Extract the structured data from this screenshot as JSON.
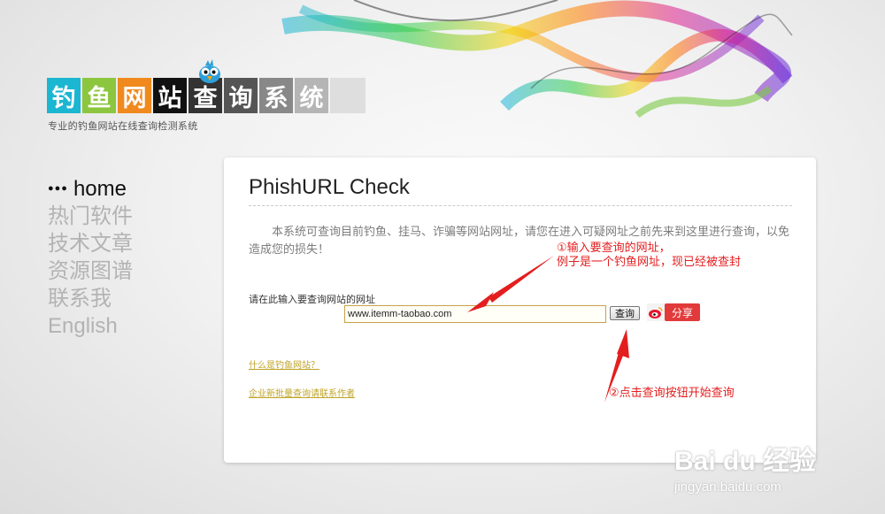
{
  "logo": {
    "chars": [
      "钓",
      "鱼",
      "网",
      "站",
      "查",
      "询",
      "系",
      "统"
    ],
    "colors": [
      "#1bb6d2",
      "#8cc63f",
      "#f08a1e",
      "#111111",
      "#333333",
      "#555555",
      "#888888",
      "#b5b5b5"
    ],
    "tagline": "专业的钓鱼网站在线查询检测系统"
  },
  "nav": {
    "active_dots": "●●●",
    "items": [
      "home",
      "热门软件",
      "技术文章",
      "资源图谱",
      "联系我",
      "English"
    ]
  },
  "main": {
    "title": "PhishURL Check",
    "intro": "本系统可查询目前钓鱼、挂马、诈骗等网站网址，请您在进入可疑网址之前先来到这里进行查询，以免造成您的损失！",
    "input_label": "请在此输入要查询网站的网址",
    "input_value": "www.itemm-taobao.com",
    "query_label": "查询",
    "share_label": "分享",
    "link_what_is": "什么是钓鱼网站？",
    "link_contact": "企业新批量查询请联系作者"
  },
  "annotations": {
    "note1_line1": "①输入要查询的网址，",
    "note1_line2": "例子是一个钓鱼网址，现已经被查封",
    "note2": "②点击查询按钮开始查询"
  },
  "watermark": {
    "brand": "Bai du 经验",
    "url": "jingyan.baidu.com"
  }
}
